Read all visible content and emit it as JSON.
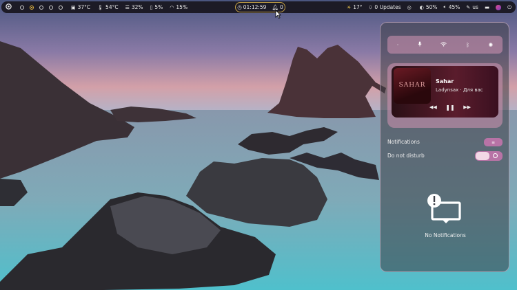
{
  "topbar": {
    "workspaces": 6,
    "active_workspace": 2,
    "cpu_temp": "37°C",
    "gpu_temp": "54°C",
    "memory": "32%",
    "battery_left": "5%",
    "cpu_usage": "15%",
    "clock": "01:12:59",
    "notif_count": "0",
    "weather": "17°",
    "updates": "0 Updates",
    "brightness": "50%",
    "volume": "45%",
    "keyboard_layout": "us"
  },
  "panel": {
    "player": {
      "cover_text": "SAHAR",
      "title": "Sahar",
      "artist": "Ladynsax · Для вас"
    },
    "notifications_label": "Notifications",
    "dnd_label": "Do not disturb",
    "empty_label": "No Notifications"
  },
  "colors": {
    "accent": "#b873a6",
    "clock_border": "#c8a446",
    "active_ws": "#e6b840"
  }
}
